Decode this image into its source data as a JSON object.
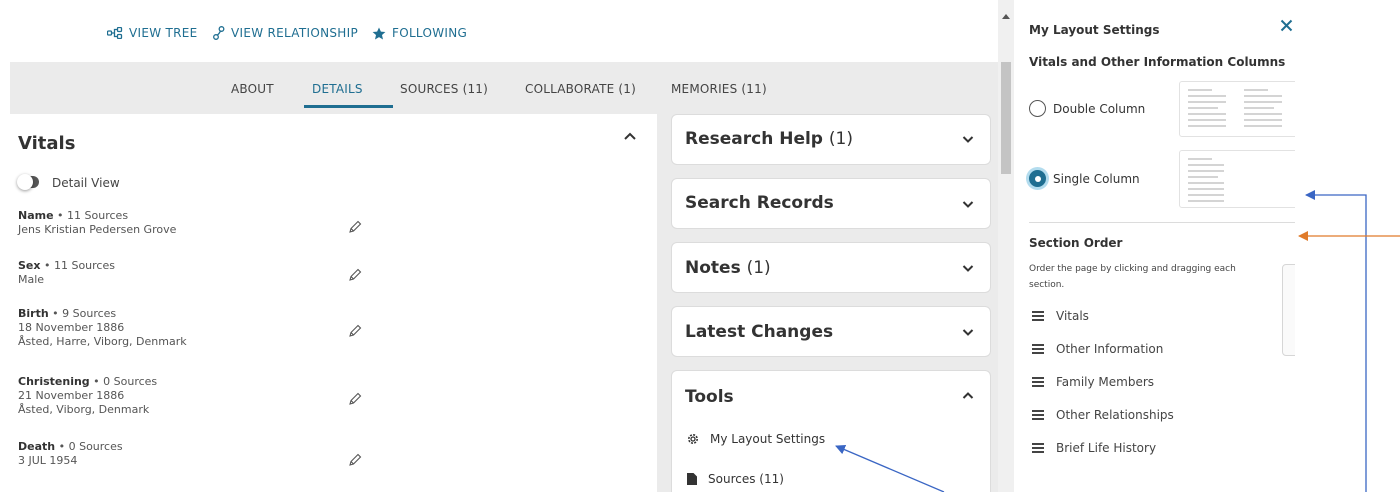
{
  "top_links": {
    "view_tree": "VIEW TREE",
    "view_relationship": "VIEW RELATIONSHIP",
    "following": "FOLLOWING"
  },
  "tabs": [
    {
      "label": "ABOUT"
    },
    {
      "label": "DETAILS",
      "active": true
    },
    {
      "label": "SOURCES (11)"
    },
    {
      "label": "COLLABORATE (1)"
    },
    {
      "label": "MEMORIES (11)"
    }
  ],
  "vitals": {
    "title": "Vitals",
    "toggle_label": "Detail View",
    "items": [
      {
        "label": "Name",
        "sources": "11 Sources",
        "lines": [
          "Jens Kristian Pedersen Grove"
        ]
      },
      {
        "label": "Sex",
        "sources": "11 Sources",
        "lines": [
          "Male"
        ]
      },
      {
        "label": "Birth",
        "sources": "9 Sources",
        "lines": [
          "18 November 1886",
          "Åsted, Harre, Viborg, Denmark"
        ]
      },
      {
        "label": "Christening",
        "sources": "0 Sources",
        "lines": [
          "21 November 1886",
          "Åsted, Viborg, Denmark"
        ]
      },
      {
        "label": "Death",
        "sources": "0 Sources",
        "lines": [
          "3 JUL 1954"
        ]
      }
    ]
  },
  "right_cards": [
    {
      "title": "Research Help",
      "count": "(1)",
      "expanded": false
    },
    {
      "title": "Search Records",
      "count": "",
      "expanded": false
    },
    {
      "title": "Notes",
      "count": "(1)",
      "expanded": false
    },
    {
      "title": "Latest Changes",
      "count": "",
      "expanded": false
    },
    {
      "title": "Tools",
      "count": "",
      "expanded": true
    }
  ],
  "tools": {
    "items": [
      {
        "label": "My Layout Settings",
        "icon": "gear-icon"
      },
      {
        "label": "Sources (11)",
        "icon": "document-icon"
      }
    ]
  },
  "layout_panel": {
    "title": "My Layout Settings",
    "columns_heading": "Vitals and Other Information Columns",
    "options": [
      {
        "label": "Double Column",
        "checked": false
      },
      {
        "label": "Single Column",
        "checked": true
      }
    ],
    "section_order_title": "Section Order",
    "section_order_desc": "Order the page by clicking and dragging each section.",
    "sections": [
      "Vitals",
      "Other Information",
      "Family Members",
      "Other Relationships",
      "Brief Life History"
    ]
  },
  "colors": {
    "accent": "#1f6e91",
    "arrow_blue": "#3a66c4",
    "arrow_orange": "#e07b2a"
  }
}
